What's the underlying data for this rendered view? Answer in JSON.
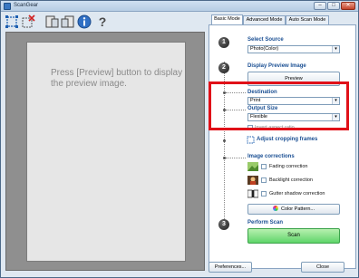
{
  "window": {
    "title": "ScanGear",
    "controls": {
      "minimize": "–",
      "maximize": "□",
      "close": "✕"
    }
  },
  "toolbar": {
    "icons": [
      "crop-icon",
      "remove-crop-icon",
      "rotate-left-icon",
      "rotate-right-icon",
      "info-icon",
      "help-icon"
    ]
  },
  "preview": {
    "message": "Press [Preview] button to display the preview image."
  },
  "tabs": [
    {
      "label": "Basic Mode",
      "active": true
    },
    {
      "label": "Advanced Mode",
      "active": false
    },
    {
      "label": "Auto Scan Mode",
      "active": false
    }
  ],
  "steps": {
    "one": "1",
    "two": "2",
    "three": "3"
  },
  "select_source": {
    "heading": "Select Source",
    "value": "Photo(Color)"
  },
  "display_preview": {
    "heading": "Display Preview Image",
    "button": "Preview"
  },
  "destination": {
    "heading": "Destination",
    "value": "Print"
  },
  "output_size": {
    "heading": "Output Size",
    "value": "Flexible"
  },
  "invert_aspect": {
    "label": "Invert aspect ratio"
  },
  "adjust_cropping": {
    "label": "Adjust cropping frames"
  },
  "image_corrections": {
    "heading": "Image corrections",
    "items": [
      {
        "label": "Fading correction"
      },
      {
        "label": "Backlight correction"
      },
      {
        "label": "Gutter shadow correction"
      }
    ],
    "color_pattern_button": "Color Pattern..."
  },
  "perform_scan": {
    "heading": "Perform Scan",
    "button": "Scan"
  },
  "footer": {
    "preferences": "Preferences...",
    "close": "Close"
  },
  "colors": {
    "accent_heading": "#1a4f93",
    "highlight": "#e01018",
    "scan_button": "#5fd56a"
  }
}
